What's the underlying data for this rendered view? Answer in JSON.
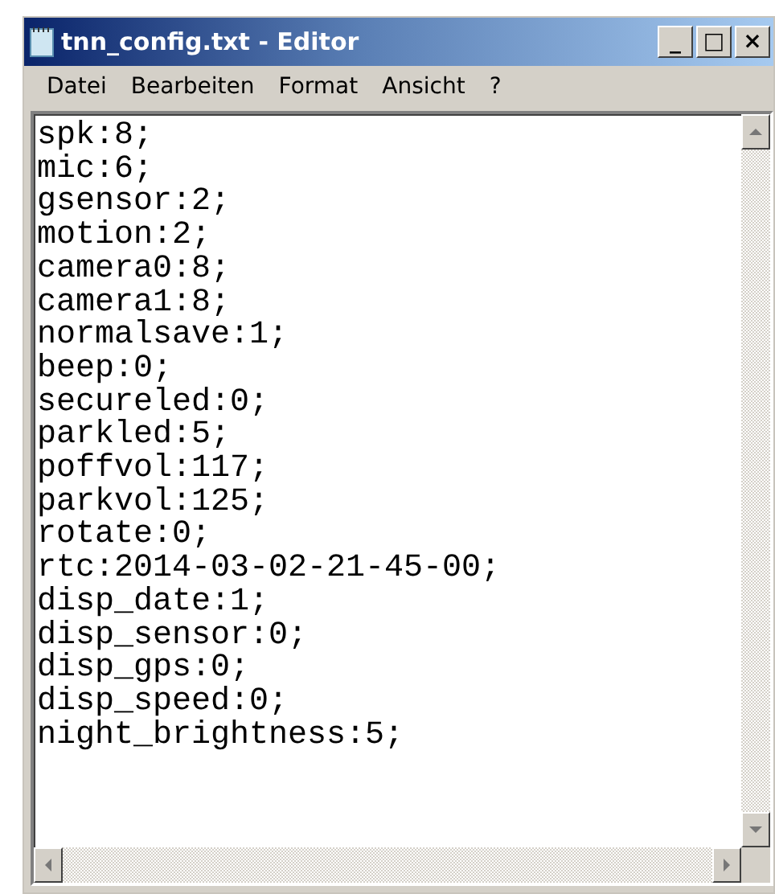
{
  "window": {
    "title": "tnn_config.txt - Editor",
    "buttons": [
      "_",
      "□",
      "×"
    ]
  },
  "menu": [
    "Datei",
    "Bearbeiten",
    "Format",
    "Ansicht",
    "?"
  ],
  "lines": [
    "spk:8;",
    "mic:6;",
    "gsensor:2;",
    "motion:2;",
    "camera0:8;",
    "camera1:8;",
    "normalsave:1;",
    "beep:0;",
    "secureled:0;",
    "parkled:5;",
    "poffvol:117;",
    "parkvol:125;",
    "rotate:0;",
    "rtc:2014-03-02-21-45-00;",
    "disp_date:1;",
    "disp_sensor:0;",
    "disp_gps:0;",
    "disp_speed:0;",
    "night_brightness:5;"
  ]
}
